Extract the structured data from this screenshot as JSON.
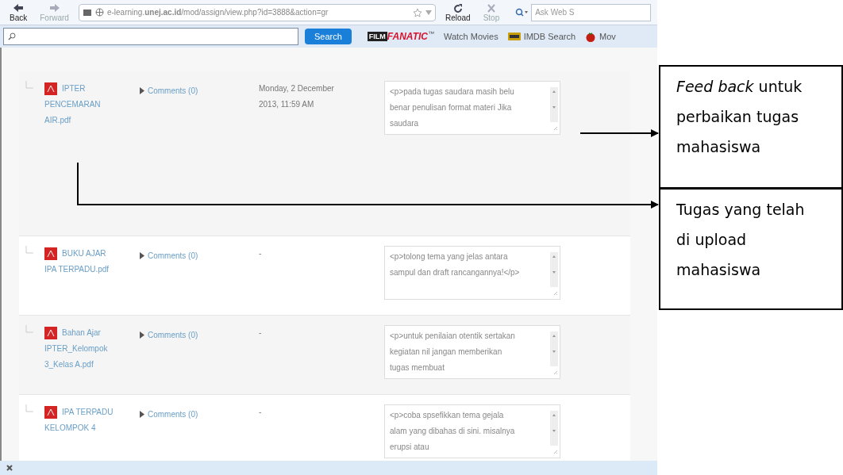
{
  "browser": {
    "left_buttons": [
      {
        "label": "Back",
        "disabled": false
      },
      {
        "label": "Forward",
        "disabled": true
      }
    ],
    "url": "e-learning.**unej.ac.id**/mod/assign/view.php?id=3888&action=gr",
    "right_buttons": [
      {
        "label": "Reload",
        "disabled": false
      },
      {
        "label": "Stop",
        "disabled": true
      }
    ],
    "web_search": {
      "placeholder": "Ask Web S"
    }
  },
  "toolbar": {
    "search_button": "Search",
    "logo_box": "FILM",
    "logo_word": "FANATIC",
    "logo_mark": "™",
    "links": [
      {
        "label": "Watch Movies",
        "kind": "text"
      },
      {
        "label": "IMDB Search",
        "kind": "imdb"
      },
      {
        "label": "Mov",
        "kind": "tomato"
      }
    ]
  },
  "submissions": [
    {
      "file": "IPTER PENCEMARAN AIR.pdf",
      "comments": "Comments (0)",
      "date": "Monday, 2 December 2013, 11:59 AM",
      "feedback": "<p>pada tugas saudara masih belu benar penulisan format materi  Jika saudara"
    },
    {
      "file": "BUKU AJAR IPA TERPADU.pdf",
      "comments": "Comments (0)",
      "date": "-",
      "feedback": "<p>tolong tema yang jelas antara sampul dan draft rancangannya!</p>"
    },
    {
      "file": "Bahan Ajar IPTER_Kelompok 3_Kelas A.pdf",
      "comments": "Comments (0)",
      "date": "-",
      "feedback": "<p>untuk penilaian otentik sertakan kegiatan nil jangan memberikan tugas membuat"
    },
    {
      "file": "IPA TERPADU KELOMPOK 4",
      "comments": "Comments (0)",
      "date": "-",
      "feedback": "<p>coba spsefikkan tema gejala alam yang dibahas di sini. misalnya erupsi atau"
    }
  ],
  "callouts": [
    {
      "text": "*Feed back* untuk perbaikan tugas mahasiswa"
    },
    {
      "text": "Tugas yang telah di upload mahasiswa"
    }
  ]
}
